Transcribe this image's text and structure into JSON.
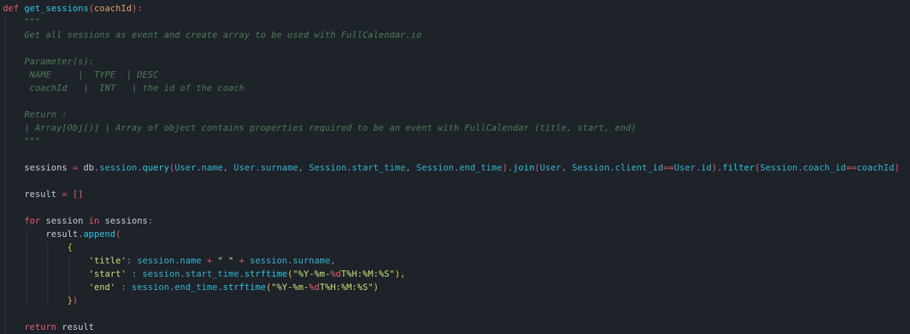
{
  "editor": {
    "language": "python",
    "theme_colors": {
      "background": "#1e2329",
      "keyword": "#e35c72",
      "function": "#2ec8e6",
      "parameter": "#e8a06a",
      "docstring": "#4d7a5a",
      "string": "#c7e07a",
      "attribute": "#37b3d2"
    },
    "lines": [
      [
        {
          "t": "def",
          "c": "kw"
        },
        {
          "t": " ",
          "c": "plain"
        },
        {
          "t": "get_sessions",
          "c": "fn"
        },
        {
          "t": "(",
          "c": "paren1"
        },
        {
          "t": "coachId",
          "c": "param"
        },
        {
          "t": "):",
          "c": "paren1"
        }
      ],
      [
        {
          "t": "    \"\"\"",
          "c": "doc"
        }
      ],
      [
        {
          "t": "    Get all sessions as event and create array to be used with FullCalendar.io",
          "c": "doc"
        }
      ],
      [
        {
          "t": "",
          "c": "plain"
        }
      ],
      [
        {
          "t": "    Parameter(s):",
          "c": "doc"
        }
      ],
      [
        {
          "t": "     NAME     |  TYPE  | DESC",
          "c": "doc"
        }
      ],
      [
        {
          "t": "     coachId   |  INT   | the id of the coach",
          "c": "doc"
        }
      ],
      [
        {
          "t": "",
          "c": "plain"
        }
      ],
      [
        {
          "t": "    Return :",
          "c": "doc"
        }
      ],
      [
        {
          "t": "    | Array[Obj()] | Array of object contains properties required to be an event with FullCalendar (title, start, end)",
          "c": "doc"
        }
      ],
      [
        {
          "t": "    \"\"\"",
          "c": "doc"
        }
      ],
      [
        {
          "t": "",
          "c": "plain"
        }
      ],
      [
        {
          "t": "    sessions",
          "c": "var"
        },
        {
          "t": " = ",
          "c": "op"
        },
        {
          "t": "db",
          "c": "var"
        },
        {
          "t": ".",
          "c": "punc"
        },
        {
          "t": "session",
          "c": "attr"
        },
        {
          "t": ".",
          "c": "punc"
        },
        {
          "t": "query",
          "c": "fn"
        },
        {
          "t": "(",
          "c": "paren1"
        },
        {
          "t": "User",
          "c": "cls"
        },
        {
          "t": ".",
          "c": "punc"
        },
        {
          "t": "name",
          "c": "attr"
        },
        {
          "t": ", ",
          "c": "punc"
        },
        {
          "t": "User",
          "c": "cls"
        },
        {
          "t": ".",
          "c": "punc"
        },
        {
          "t": "surname",
          "c": "attr"
        },
        {
          "t": ", ",
          "c": "punc"
        },
        {
          "t": "Session",
          "c": "cls"
        },
        {
          "t": ".",
          "c": "punc"
        },
        {
          "t": "start_time",
          "c": "attr"
        },
        {
          "t": ", ",
          "c": "punc"
        },
        {
          "t": "Session",
          "c": "cls"
        },
        {
          "t": ".",
          "c": "punc"
        },
        {
          "t": "end_time",
          "c": "attr"
        },
        {
          "t": ")",
          "c": "paren1"
        },
        {
          "t": ".",
          "c": "punc"
        },
        {
          "t": "join",
          "c": "fn"
        },
        {
          "t": "(",
          "c": "paren1"
        },
        {
          "t": "User",
          "c": "cls"
        },
        {
          "t": ", ",
          "c": "punc"
        },
        {
          "t": "Session",
          "c": "cls"
        },
        {
          "t": ".",
          "c": "punc"
        },
        {
          "t": "client_id",
          "c": "attr"
        },
        {
          "t": "==",
          "c": "op"
        },
        {
          "t": "User",
          "c": "cls"
        },
        {
          "t": ".",
          "c": "punc"
        },
        {
          "t": "id",
          "c": "attr"
        },
        {
          "t": ")",
          "c": "paren1"
        },
        {
          "t": ".",
          "c": "punc"
        },
        {
          "t": "filter",
          "c": "fn"
        },
        {
          "t": "(",
          "c": "paren1"
        },
        {
          "t": "Session",
          "c": "cls"
        },
        {
          "t": ".",
          "c": "punc"
        },
        {
          "t": "coach_id",
          "c": "attr"
        },
        {
          "t": "==",
          "c": "op"
        },
        {
          "t": "coachId",
          "c": "attr"
        },
        {
          "t": ")",
          "c": "paren1"
        }
      ],
      [
        {
          "t": "",
          "c": "plain"
        }
      ],
      [
        {
          "t": "    result",
          "c": "var"
        },
        {
          "t": " = ",
          "c": "op"
        },
        {
          "t": "[]",
          "c": "paren1"
        }
      ],
      [
        {
          "t": "",
          "c": "plain"
        }
      ],
      [
        {
          "t": "    ",
          "c": "plain"
        },
        {
          "t": "for",
          "c": "kw"
        },
        {
          "t": " session ",
          "c": "var"
        },
        {
          "t": "in",
          "c": "kw"
        },
        {
          "t": " sessions",
          "c": "var"
        },
        {
          "t": ":",
          "c": "punc"
        }
      ],
      [
        {
          "t": "        result",
          "c": "var"
        },
        {
          "t": ".",
          "c": "punc"
        },
        {
          "t": "append",
          "c": "fn"
        },
        {
          "t": "(",
          "c": "paren1"
        }
      ],
      [
        {
          "t": "            ",
          "c": "plain"
        },
        {
          "t": "{",
          "c": "brace"
        }
      ],
      [
        {
          "t": "                ",
          "c": "plain"
        },
        {
          "t": "'title'",
          "c": "str"
        },
        {
          "t": ": ",
          "c": "punc"
        },
        {
          "t": "session",
          "c": "attr"
        },
        {
          "t": ".",
          "c": "punc"
        },
        {
          "t": "name",
          "c": "attr"
        },
        {
          "t": " + ",
          "c": "op"
        },
        {
          "t": "\" \"",
          "c": "str"
        },
        {
          "t": " + ",
          "c": "op"
        },
        {
          "t": "session",
          "c": "attr"
        },
        {
          "t": ".",
          "c": "punc"
        },
        {
          "t": "surname",
          "c": "attr"
        },
        {
          "t": ",",
          "c": "punc"
        }
      ],
      [
        {
          "t": "                ",
          "c": "plain"
        },
        {
          "t": "'start'",
          "c": "str"
        },
        {
          "t": " : ",
          "c": "punc"
        },
        {
          "t": "session",
          "c": "attr"
        },
        {
          "t": ".",
          "c": "punc"
        },
        {
          "t": "start_time",
          "c": "attr"
        },
        {
          "t": ".",
          "c": "punc"
        },
        {
          "t": "strftime",
          "c": "fn"
        },
        {
          "t": "(",
          "c": "paren2"
        },
        {
          "t": "\"%Y-%m-",
          "c": "str"
        },
        {
          "t": "%d",
          "c": "strfmt"
        },
        {
          "t": "T%H:%M:%S\"",
          "c": "str"
        },
        {
          "t": "),",
          "c": "paren2"
        }
      ],
      [
        {
          "t": "                ",
          "c": "plain"
        },
        {
          "t": "'end'",
          "c": "str"
        },
        {
          "t": " : ",
          "c": "punc"
        },
        {
          "t": "session",
          "c": "attr"
        },
        {
          "t": ".",
          "c": "punc"
        },
        {
          "t": "end_time",
          "c": "attr"
        },
        {
          "t": ".",
          "c": "punc"
        },
        {
          "t": "strftime",
          "c": "fn"
        },
        {
          "t": "(",
          "c": "paren2"
        },
        {
          "t": "\"%Y-%m-",
          "c": "str"
        },
        {
          "t": "%d",
          "c": "strfmt"
        },
        {
          "t": "T%H:%M:%S\"",
          "c": "str"
        },
        {
          "t": ")",
          "c": "paren2"
        }
      ],
      [
        {
          "t": "            ",
          "c": "plain"
        },
        {
          "t": "}",
          "c": "brace"
        },
        {
          "t": ")",
          "c": "paren1"
        }
      ],
      [
        {
          "t": "",
          "c": "plain"
        }
      ],
      [
        {
          "t": "    ",
          "c": "plain"
        },
        {
          "t": "return",
          "c": "kw"
        },
        {
          "t": " result",
          "c": "var"
        }
      ]
    ]
  }
}
